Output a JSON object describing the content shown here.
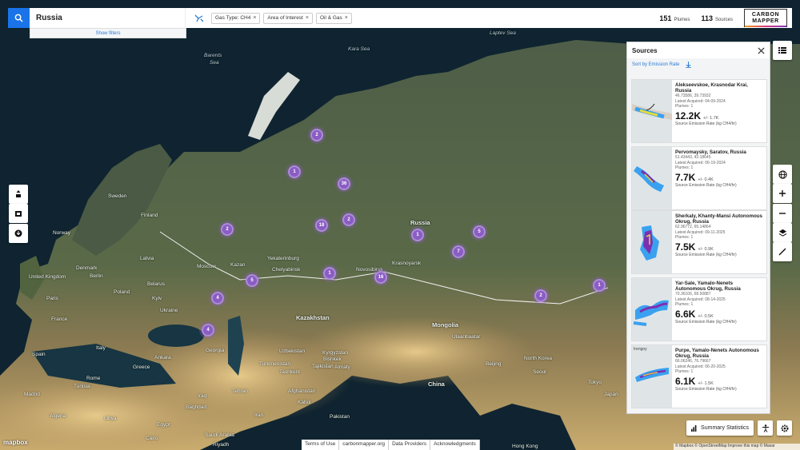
{
  "search": {
    "value": "Russia"
  },
  "filters": [
    {
      "label": "Gas Type: CH4"
    },
    {
      "label": "Area of Interest"
    },
    {
      "label": "Oil & Gas"
    }
  ],
  "show_filters_label": "Show filters",
  "stats": {
    "plumes_count": "151",
    "plumes_label": "Plumes",
    "sources_count": "113",
    "sources_label": "Sources"
  },
  "logo": {
    "line1": "CARBON",
    "line2": "MAPPER"
  },
  "map": {
    "labels": [
      {
        "text": "Barents",
        "cls": "sea"
      },
      {
        "text": "Sea",
        "cls": "sea"
      },
      {
        "text": "Kara Sea",
        "cls": "sea"
      },
      {
        "text": "Laptev Sea",
        "cls": "sea"
      },
      {
        "text": "Sweden",
        "cls": ""
      },
      {
        "text": "Finland",
        "cls": ""
      },
      {
        "text": "Norway",
        "cls": ""
      },
      {
        "text": "Denmark",
        "cls": ""
      },
      {
        "text": "United Kingdom",
        "cls": ""
      },
      {
        "text": "Poland",
        "cls": ""
      },
      {
        "text": "Belarus",
        "cls": ""
      },
      {
        "text": "Ukraine",
        "cls": ""
      },
      {
        "text": "France",
        "cls": ""
      },
      {
        "text": "Italy",
        "cls": ""
      },
      {
        "text": "Spain",
        "cls": ""
      },
      {
        "text": "Greece",
        "cls": ""
      },
      {
        "text": "Moscow",
        "cls": ""
      },
      {
        "text": "Kazan",
        "cls": ""
      },
      {
        "text": "Yekaterinburg",
        "cls": ""
      },
      {
        "text": "Chelyabinsk",
        "cls": ""
      },
      {
        "text": "Novosibirsk",
        "cls": ""
      },
      {
        "text": "Krasnoyarsk",
        "cls": ""
      },
      {
        "text": "Russia",
        "cls": "big"
      },
      {
        "text": "Kazakhstan",
        "cls": "big"
      },
      {
        "text": "Mongolia",
        "cls": "big"
      },
      {
        "text": "Uzbekistan",
        "cls": ""
      },
      {
        "text": "Kyrgyzstan",
        "cls": ""
      },
      {
        "text": "Turkmenistan",
        "cls": ""
      },
      {
        "text": "Tajikistan",
        "cls": ""
      },
      {
        "text": "Afghanistan",
        "cls": ""
      },
      {
        "text": "Iran",
        "cls": ""
      },
      {
        "text": "Iraq",
        "cls": ""
      },
      {
        "text": "China",
        "cls": "big"
      },
      {
        "text": "Pakistan",
        "cls": ""
      },
      {
        "text": "Libya",
        "cls": ""
      },
      {
        "text": "Egypt",
        "cls": ""
      },
      {
        "text": "Algeria",
        "cls": ""
      },
      {
        "text": "Tunisia",
        "cls": ""
      },
      {
        "text": "Saudi Arabia",
        "cls": ""
      },
      {
        "text": "Latvia",
        "cls": ""
      },
      {
        "text": "Georgia",
        "cls": ""
      },
      {
        "text": "Seoul",
        "cls": ""
      },
      {
        "text": "Tokyo",
        "cls": ""
      },
      {
        "text": "Japan",
        "cls": ""
      },
      {
        "text": "North Korea",
        "cls": ""
      },
      {
        "text": "Beijing",
        "cls": ""
      },
      {
        "text": "Ulaanbaatar",
        "cls": ""
      },
      {
        "text": "Tashkent",
        "cls": ""
      },
      {
        "text": "Bishkek",
        "cls": ""
      },
      {
        "text": "Almaty",
        "cls": ""
      },
      {
        "text": "Kabul",
        "cls": ""
      },
      {
        "text": "Tehran",
        "cls": ""
      },
      {
        "text": "Baghdad",
        "cls": ""
      },
      {
        "text": "Ankara",
        "cls": ""
      },
      {
        "text": "Cairo",
        "cls": ""
      },
      {
        "text": "Riyadh",
        "cls": ""
      },
      {
        "text": "Berlin",
        "cls": ""
      },
      {
        "text": "Kyiv",
        "cls": ""
      },
      {
        "text": "Paris",
        "cls": ""
      },
      {
        "text": "Madrid",
        "cls": ""
      },
      {
        "text": "Rome",
        "cls": ""
      },
      {
        "text": "Hong Kong",
        "cls": ""
      }
    ],
    "clusters": [
      "2",
      "1",
      "36",
      "18",
      "2",
      "2",
      "1",
      "5",
      "7",
      "1",
      "5",
      "16",
      "4",
      "4",
      "2",
      "1"
    ]
  },
  "panel": {
    "title": "Sources",
    "sort_label": "Sort by Emission Rate",
    "unit_label": "Source Emission Rate (kg CH4/hr)",
    "sources": [
      {
        "name": "Alekseevskoe, Krasnodar Krai, Russia",
        "coords": "46.73586, 39.73932",
        "acquired": "Latest Acquired: 04-09-2024",
        "plumes": "Plumes: 1",
        "rate": "12.2K",
        "uncertainty": "+/- 1.7K",
        "thumb_label": ""
      },
      {
        "name": "Pervomaysky, Saratov, Russia",
        "coords": "51.43443, 43.18645",
        "acquired": "Latest Acquired: 06-19-2024",
        "plumes": "Plumes: 1",
        "rate": "7.7K",
        "uncertainty": "+/- 0.4K",
        "thumb_label": ""
      },
      {
        "name": "Sherkaly, Khanty-Mansi Autonomous Okrug, Russia",
        "coords": "62.96772, 65.14864",
        "acquired": "Latest Acquired: 09-11-2025",
        "plumes": "Plumes: 1",
        "rate": "7.5K",
        "uncertainty": "+/- 0.9K",
        "thumb_label": ""
      },
      {
        "name": "Yar-Sale, Yamalo-Nenets Autonomous Okrug, Russia",
        "coords": "70.36106, 68.50887",
        "acquired": "Latest Acquired: 08-14-2025",
        "plumes": "Plumes: 1",
        "rate": "6.6K",
        "uncertainty": "+/- 0.5K",
        "thumb_label": ""
      },
      {
        "name": "Purpe, Yamalo-Nenets Autonomous Okrug, Russia",
        "coords": "66.06246, 76.79667",
        "acquired": "Latest Acquired: 06-20-2025",
        "plumes": "Plumes: 1",
        "rate": "6.1K",
        "uncertainty": "+/- 1.5K",
        "thumb_label": "Irengoy"
      }
    ]
  },
  "summary_label": "Summary Statistics",
  "bottom_links": [
    "Terms of Use",
    "carbonmapper.org",
    "Data Providers",
    "Acknowledgments"
  ],
  "mapbox_label": "mapbox",
  "attribution": "© Mapbox © OpenStreetMap  Improve this map © Maxar"
}
